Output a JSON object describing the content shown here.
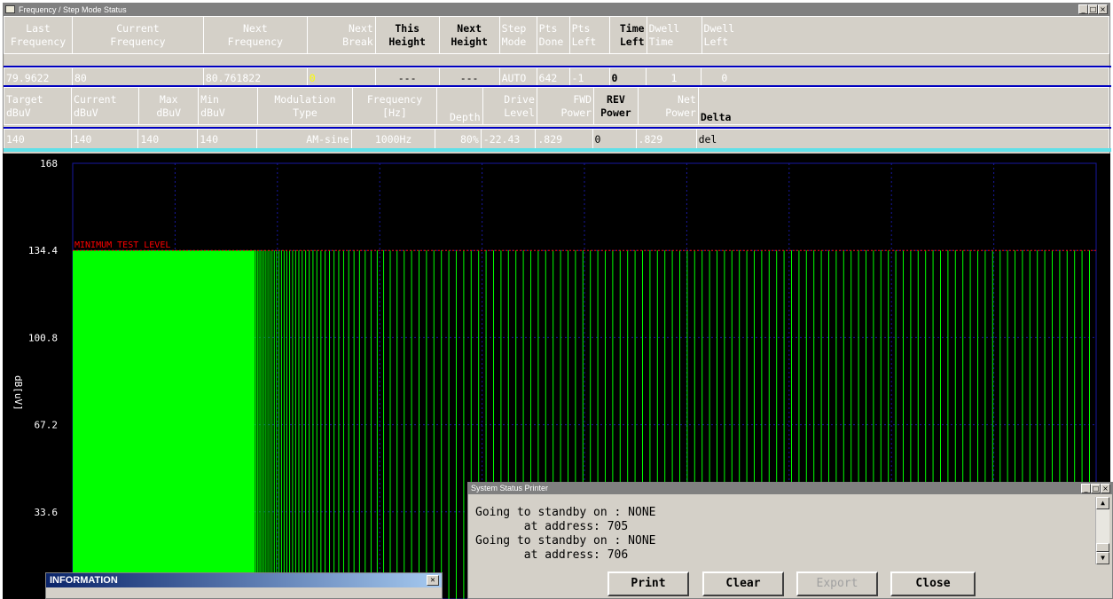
{
  "window": {
    "title": "Frequency / Step Mode Status",
    "controls": [
      "_",
      "□",
      "×"
    ]
  },
  "status_row1": {
    "headers": [
      "Last\nFrequency",
      "Current\nFrequency",
      "Next\nFrequency",
      "Next\nBreak",
      "This\nHeight",
      "Next\nHeight",
      "Step\nMode",
      "Pts\nDone",
      "Pts\nLeft",
      "Time\nLeft",
      "Dwell\nTime",
      "Dwell\nLeft"
    ],
    "values": [
      "79.9622",
      "80",
      "80.761822",
      "0",
      "---",
      "---",
      "AUTO",
      "642",
      "-1",
      "0",
      "1",
      "0"
    ]
  },
  "status_row2": {
    "headers": [
      "Target\ndBuV",
      "Current\ndBuV",
      "Max\ndBuV",
      "Min\ndBuV",
      "Modulation\nType",
      "Frequency\n[Hz]",
      "Depth",
      "Drive\nLevel",
      "FWD\nPower",
      "REV\nPower",
      "Net\nPower",
      "Delta"
    ],
    "values": [
      "140",
      "140",
      "140",
      "140",
      "AM-sine",
      "1000Hz",
      "80%",
      "-22.43",
      ".829",
      "0",
      ".829",
      "del"
    ]
  },
  "chart_data": {
    "type": "bar",
    "ylabel": "dB[uV]",
    "ylim": [
      0,
      168
    ],
    "y_ticks": [
      "168",
      "134.4",
      "100.8",
      "67.2",
      "33.6"
    ],
    "threshold_label": "MINIMUM TEST LEVEL",
    "threshold_value": 134.4,
    "series": [
      {
        "name": "",
        "level": 134.4
      }
    ],
    "colors": {
      "bars": "#00ff00",
      "threshold": "#ff0000",
      "grid": "#1818a0",
      "background": "#000000"
    }
  },
  "printer": {
    "title": "System Status Printer",
    "log": "Going to standby on : NONE\n       at address: 705\nGoing to standby on : NONE\n       at address: 706",
    "buttons": {
      "print": "Print",
      "clear": "Clear",
      "export": "Export",
      "close": "Close"
    }
  },
  "info": {
    "title": "INFORMATION"
  }
}
